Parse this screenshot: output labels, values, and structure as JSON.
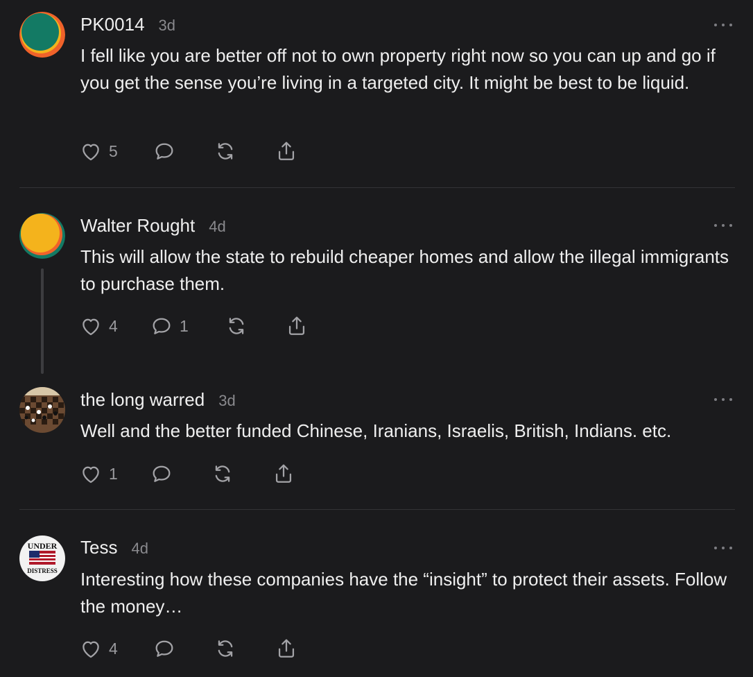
{
  "comments": [
    {
      "name": "PK0014",
      "time": "3d",
      "text": "I fell like you are better off not to own property right now so you can up and go if you get the sense you’re living in a targeted city. It might be best to be liquid.",
      "likes": "5",
      "replies": "",
      "avatar": "green-orange-circle"
    },
    {
      "name": "Walter Rought",
      "time": "4d",
      "text": "This will allow the state to rebuild cheaper homes and allow the illegal immigrants to purchase them.",
      "likes": "4",
      "replies": "1",
      "avatar": "yellow-orange-green-circle"
    },
    {
      "name": "the long warred",
      "time": "3d",
      "text": "Well and the better funded Chinese, Iranians, Israelis, British, Indians. etc.",
      "likes": "1",
      "replies": "",
      "avatar": "chessboard-photo"
    },
    {
      "name": "Tess",
      "time": "4d",
      "text": "Interesting how these companies have the “insight” to protect their assets. Follow the money…",
      "likes": "4",
      "replies": "",
      "avatar": "under-distress-flag-logo",
      "avatar_text_top": "UNDER",
      "avatar_text_bottom": "DISTRESS"
    }
  ],
  "icons": {
    "like": "heart-icon",
    "reply": "speech-bubble-icon",
    "restack": "restack-icon",
    "share": "share-icon",
    "more": "more-icon"
  },
  "colors": {
    "background": "#1b1b1d",
    "text": "#efefef",
    "muted": "#8a8a8e",
    "icon": "#a3a3a7",
    "divider": "#333336"
  }
}
